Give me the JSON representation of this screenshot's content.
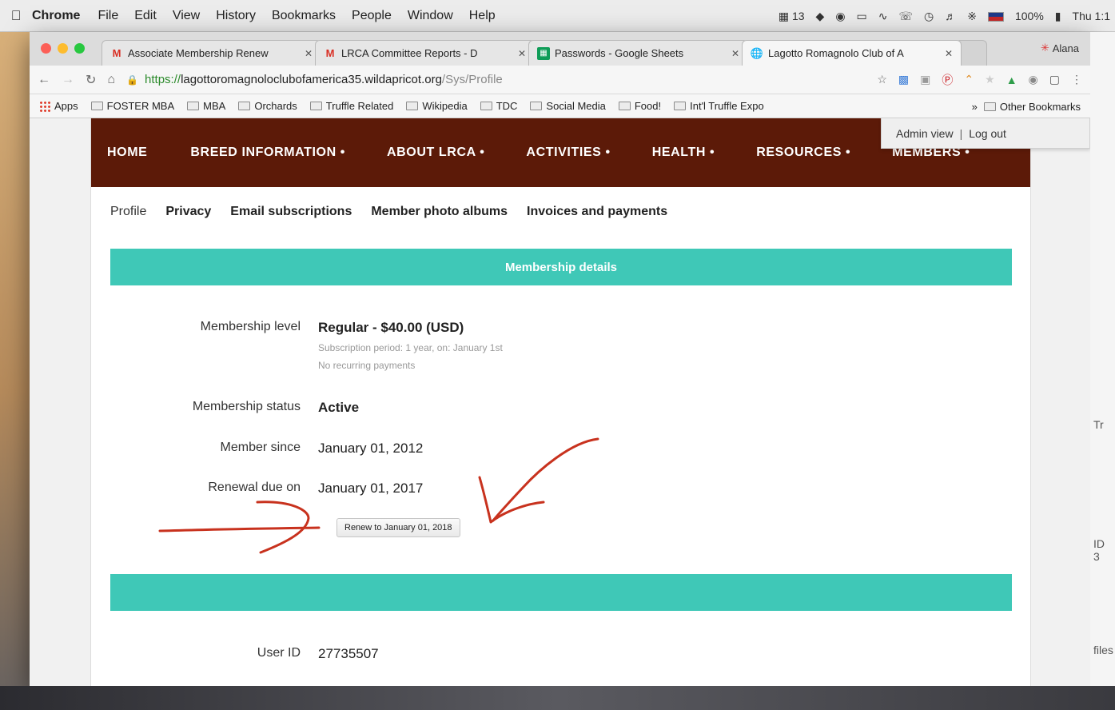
{
  "menubar": {
    "apple": "",
    "app": "Chrome",
    "items": [
      "File",
      "Edit",
      "View",
      "History",
      "Bookmarks",
      "People",
      "Window",
      "Help"
    ],
    "status": {
      "notifications": "13",
      "battery": "100%",
      "clock": "Thu 1:1"
    }
  },
  "browser": {
    "tabs": [
      {
        "title": "Associate Membership Renew",
        "icon": "gmail-icon"
      },
      {
        "title": "LRCA Committee Reports - D",
        "icon": "gmail-icon"
      },
      {
        "title": "Passwords - Google Sheets",
        "icon": "sheets-icon"
      },
      {
        "title": "Lagotto Romagnolo Club of A",
        "icon": "globe-icon"
      }
    ],
    "profile_name": "Alana",
    "url": {
      "scheme": "https://",
      "host": "lagottoromagnoloclubofamerica35.wildapricot.org",
      "path": "/Sys/Profile"
    },
    "bookmarks": [
      "Apps",
      "FOSTER MBA",
      "MBA",
      "Orchards",
      "Truffle Related",
      "Wikipedia",
      "TDC",
      "Social Media",
      "Food!",
      "Int'l Truffle Expo"
    ],
    "bookmarks_overflow": "»",
    "other_bookmarks": "Other Bookmarks"
  },
  "admin_bar": {
    "admin_view": "Admin view",
    "separator": "|",
    "log_out": "Log out"
  },
  "site_nav": {
    "items": [
      "HOME",
      "BREED INFORMATION •",
      "ABOUT LRCA •",
      "ACTIVITIES •",
      "HEALTH •",
      "RESOURCES •",
      "MEMBERS •"
    ]
  },
  "sub_nav": {
    "items": [
      "Profile",
      "Privacy",
      "Email subscriptions",
      "Member photo albums",
      "Invoices and payments"
    ]
  },
  "membership": {
    "section_title": "Membership details",
    "level_label": "Membership level",
    "level_value": "Regular - $40.00 (USD)",
    "subscription_period": "Subscription period: 1 year, on: January 1st",
    "recurring": "No recurring payments",
    "status_label": "Membership status",
    "status_value": "Active",
    "since_label": "Member since",
    "since_value": "January 01, 2012",
    "renewal_label": "Renewal due on",
    "renewal_value": "January 01, 2017",
    "renew_button": "Renew to January 01, 2018"
  },
  "account": {
    "user_id_label": "User ID",
    "user_id_value": "27735507"
  },
  "edge_texts": [
    "Tr",
    "ID",
    "3",
    "files"
  ],
  "colors": {
    "nav_bg": "#5c1a08",
    "teal": "#3fc8b7",
    "annotation_red": "#c8321e"
  }
}
